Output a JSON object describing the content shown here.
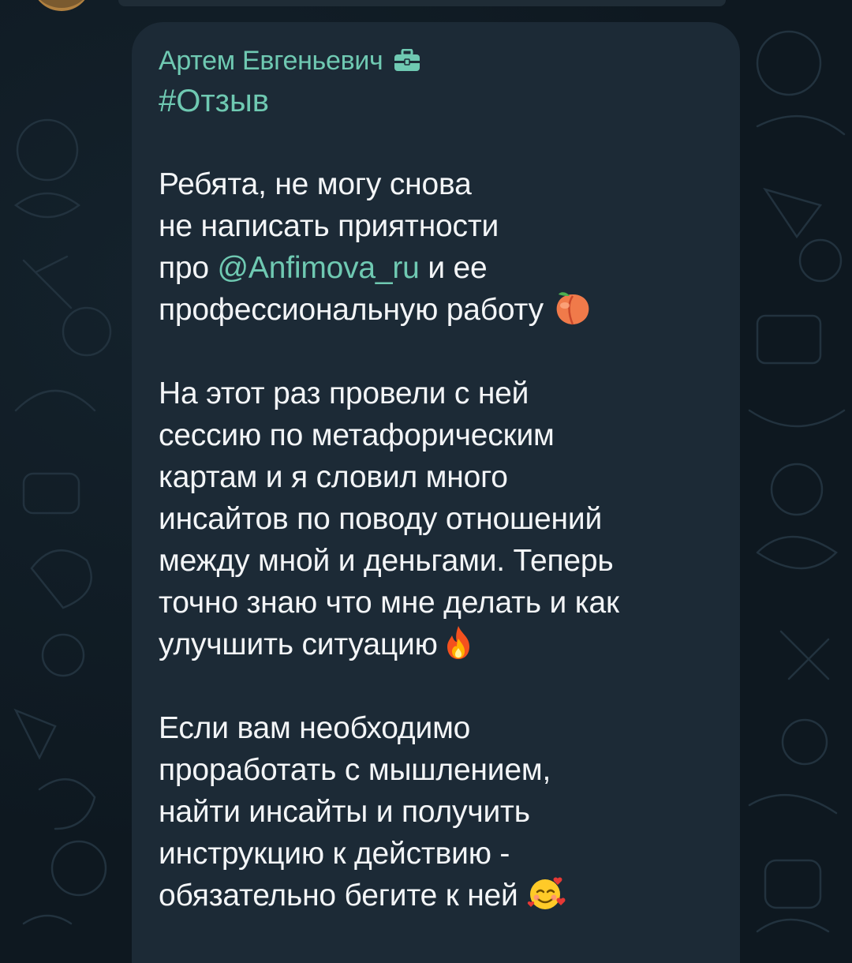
{
  "message": {
    "sender_name": "Артем Евгеньевич",
    "sender_badge_icon": "briefcase-icon",
    "hashtag": "#Отзыв",
    "paragraph1": {
      "line1": "Ребята, не могу снова",
      "line2": "не написать приятности",
      "line3_before": "про ",
      "mention": "@Anfimova_ru",
      "line3_after": " и ее",
      "line4": "профессиональную работу",
      "emoji": "peach-emoji"
    },
    "paragraph2": {
      "line1": "На этот раз провели с ней",
      "line2": "сессию по метафорическим",
      "line3": "картам и я словил много",
      "line4": "инсайтов по поводу отношений",
      "line5": "между мной и деньгами. Теперь",
      "line6": "точно знаю что мне делать и как",
      "line7": "улучшить ситуацию",
      "emoji": "fire-emoji"
    },
    "paragraph3": {
      "line1": "Если вам необходимо",
      "line2": "проработать с мышлением,",
      "line3": "найти инсайты и получить",
      "line4": "инструкцию к действию -",
      "line5": "обязательно бегите к ней",
      "emoji": "smiling-face-with-hearts-emoji"
    }
  },
  "colors": {
    "background": "#0e1820",
    "bubble": "#1c2a36",
    "accent": "#6fc9b2",
    "text": "#f3f5f7"
  }
}
